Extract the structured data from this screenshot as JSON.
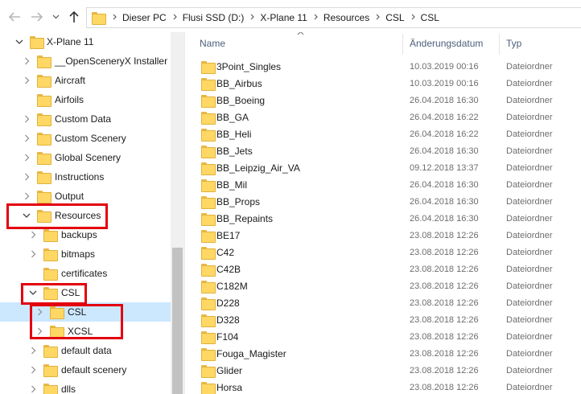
{
  "address_bar": {
    "breadcrumbs": [
      "Dieser PC",
      "Flusi SSD (D:)",
      "X-Plane 11",
      "Resources",
      "CSL",
      "CSL"
    ]
  },
  "nav": {
    "icons": [
      "back-arrow-icon",
      "forward-arrow-icon",
      "chevron-down-icon",
      "up-arrow-icon"
    ]
  },
  "tree": {
    "items": [
      {
        "label": "X-Plane 11",
        "expander": "expanded",
        "level": 0
      },
      {
        "label": "__OpenSceneryX Installer",
        "expander": "collapsed",
        "level": 1
      },
      {
        "label": "Aircraft",
        "expander": "collapsed",
        "level": 1
      },
      {
        "label": "Airfoils",
        "expander": "none",
        "level": 1
      },
      {
        "label": "Custom Data",
        "expander": "collapsed",
        "level": 1
      },
      {
        "label": "Custom Scenery",
        "expander": "collapsed",
        "level": 1
      },
      {
        "label": "Global Scenery",
        "expander": "collapsed",
        "level": 1
      },
      {
        "label": "Instructions",
        "expander": "collapsed",
        "level": 1
      },
      {
        "label": "Output",
        "expander": "collapsed",
        "level": 1
      },
      {
        "label": "Resources",
        "expander": "expanded",
        "level": 1
      },
      {
        "label": "backups",
        "expander": "collapsed",
        "level": 2
      },
      {
        "label": "bitmaps",
        "expander": "collapsed",
        "level": 2
      },
      {
        "label": "certificates",
        "expander": "none",
        "level": 2
      },
      {
        "label": "CSL",
        "expander": "expanded",
        "level": 2
      },
      {
        "label": "CSL",
        "expander": "collapsed",
        "level": 3,
        "selected": true
      },
      {
        "label": "XCSL",
        "expander": "collapsed",
        "level": 3
      },
      {
        "label": "default data",
        "expander": "collapsed",
        "level": 2
      },
      {
        "label": "default scenery",
        "expander": "collapsed",
        "level": 2
      },
      {
        "label": "dlls",
        "expander": "collapsed",
        "level": 2
      }
    ]
  },
  "columns": {
    "name": "Name",
    "date": "Änderungsdatum",
    "type": "Typ"
  },
  "files": [
    {
      "name": "3Point_Singles",
      "date": "10.03.2019 00:16",
      "type": "Dateiordner"
    },
    {
      "name": "BB_Airbus",
      "date": "10.03.2019 00:16",
      "type": "Dateiordner"
    },
    {
      "name": "BB_Boeing",
      "date": "26.04.2018 16:30",
      "type": "Dateiordner"
    },
    {
      "name": "BB_GA",
      "date": "26.04.2018 16:22",
      "type": "Dateiordner"
    },
    {
      "name": "BB_Heli",
      "date": "26.04.2018 16:22",
      "type": "Dateiordner"
    },
    {
      "name": "BB_Jets",
      "date": "26.04.2018 16:30",
      "type": "Dateiordner"
    },
    {
      "name": "BB_Leipzig_Air_VA",
      "date": "09.12.2018 13:37",
      "type": "Dateiordner"
    },
    {
      "name": "BB_Mil",
      "date": "26.04.2018 16:30",
      "type": "Dateiordner"
    },
    {
      "name": "BB_Props",
      "date": "26.04.2018 16:30",
      "type": "Dateiordner"
    },
    {
      "name": "BB_Repaints",
      "date": "26.04.2018 16:30",
      "type": "Dateiordner"
    },
    {
      "name": "BE17",
      "date": "23.08.2018 12:26",
      "type": "Dateiordner"
    },
    {
      "name": "C42",
      "date": "23.08.2018 12:26",
      "type": "Dateiordner"
    },
    {
      "name": "C42B",
      "date": "23.08.2018 12:26",
      "type": "Dateiordner"
    },
    {
      "name": "C182M",
      "date": "23.08.2018 12:26",
      "type": "Dateiordner"
    },
    {
      "name": "D228",
      "date": "23.08.2018 12:26",
      "type": "Dateiordner"
    },
    {
      "name": "D328",
      "date": "23.08.2018 12:26",
      "type": "Dateiordner"
    },
    {
      "name": "F104",
      "date": "23.08.2018 12:26",
      "type": "Dateiordner"
    },
    {
      "name": "Fouga_Magister",
      "date": "23.08.2018 12:26",
      "type": "Dateiordner"
    },
    {
      "name": "Glider",
      "date": "23.08.2018 12:26",
      "type": "Dateiordner"
    },
    {
      "name": "Horsa",
      "date": "23.08.2018 12:26",
      "type": "Dateiordner"
    }
  ],
  "colors": {
    "selection": "#cce8ff",
    "highlight_box": "#e3000f",
    "folder": "#ffd765",
    "header_text": "#4c607a"
  }
}
